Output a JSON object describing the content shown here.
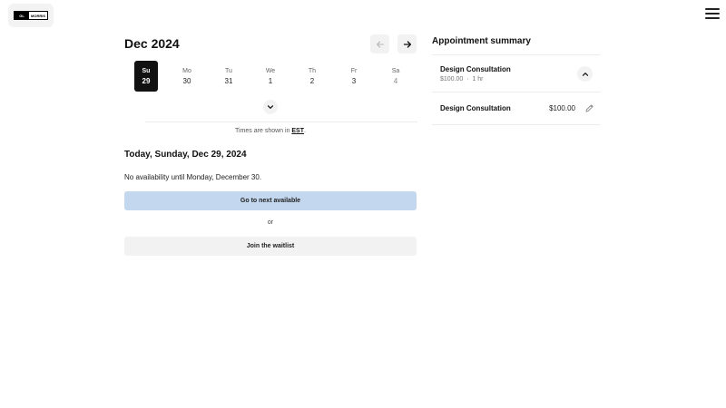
{
  "header": {
    "logo": {
      "left_text": "GL",
      "right_text": "MORRIS"
    },
    "menu_icon": "hamburger-menu-icon"
  },
  "calendar": {
    "month_label": "Dec 2024",
    "prev_icon": "arrow-left-icon",
    "next_icon": "arrow-right-icon",
    "days": [
      {
        "name": "Su",
        "num": "29",
        "selected": true
      },
      {
        "name": "Mo",
        "num": "30"
      },
      {
        "name": "Tu",
        "num": "31"
      },
      {
        "name": "We",
        "num": "1"
      },
      {
        "name": "Th",
        "num": "2"
      },
      {
        "name": "Fr",
        "num": "3"
      },
      {
        "name": "Sa",
        "num": "4",
        "muted": true
      }
    ],
    "expand_icon": "chevron-down-icon",
    "timezone_prefix": "Times are shown in ",
    "timezone": "EST",
    "timezone_suffix": "."
  },
  "availability": {
    "today_label": "Today, Sunday, Dec 29, 2024",
    "message": "No availability until Monday, December 30.",
    "next_button": "Go to next available",
    "or_text": "or",
    "waitlist_button": "Join the waitlist"
  },
  "summary": {
    "title": "Appointment summary",
    "service_name": "Design Consultation",
    "service_price": "$100.00",
    "service_separator": "·",
    "service_duration": "1 hr",
    "collapse_icon": "chevron-up-icon",
    "line_item": {
      "name": "Design Consultation",
      "price": "$100.00"
    },
    "edit_icon": "pencil-icon"
  },
  "colors": {
    "primary_button": "#c3d7ef",
    "selected_day": "#111111",
    "secondary_button": "#f2f2f2"
  }
}
